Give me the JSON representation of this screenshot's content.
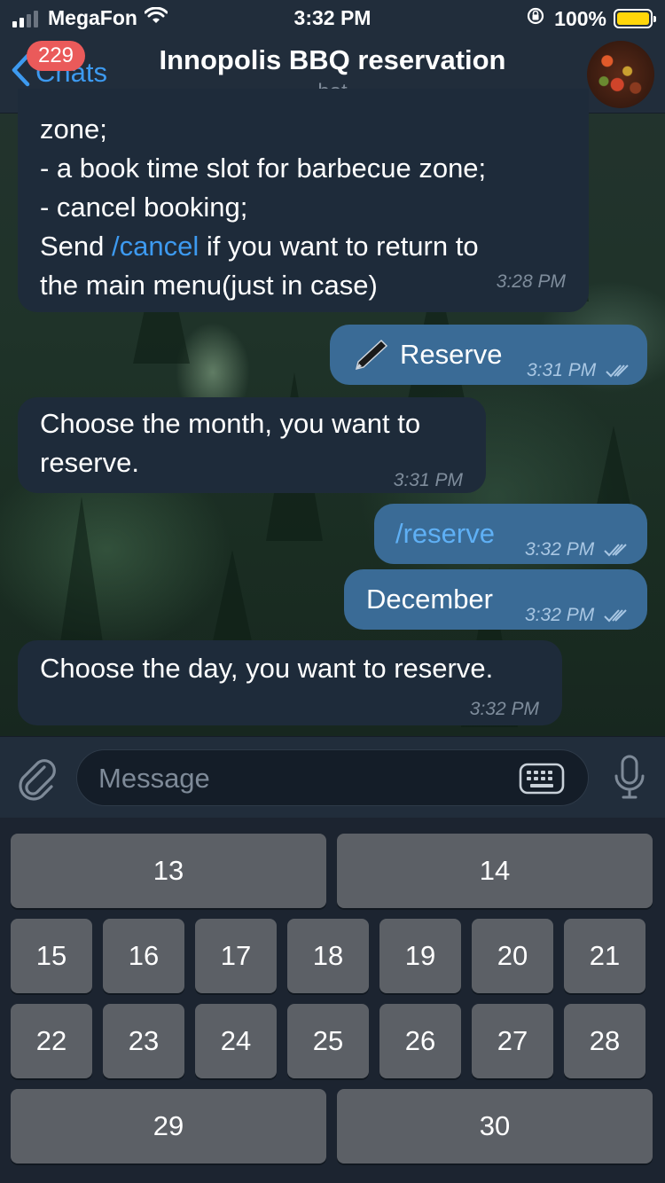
{
  "status_bar": {
    "carrier": "MegaFon",
    "time": "3:32 PM",
    "battery": "100%",
    "signal_bars": 4,
    "signal_bars_active": 2
  },
  "nav": {
    "back_label": "Chats",
    "unread_badge": "229",
    "title": "Innopolis BBQ reservation",
    "subtitle": "bot"
  },
  "messages": [
    {
      "direction": "in",
      "lines": [
        "zone;",
        "- a book time slot for barbecue zone;",
        "- cancel booking;"
      ],
      "line4_prefix": "Send ",
      "line4_link": "/cancel",
      "line4_suffix": " if you want to return to",
      "line5": "the main menu(just in case)",
      "time": "3:28 PM"
    },
    {
      "direction": "out",
      "emoji": "🖋",
      "text": "Reserve",
      "time": "3:31 PM"
    },
    {
      "direction": "in",
      "lines": [
        "Choose the month, you want to",
        "reserve."
      ],
      "time": "3:31 PM"
    },
    {
      "direction": "out",
      "text": "/reserve",
      "is_link": true,
      "time": "3:32 PM"
    },
    {
      "direction": "out",
      "text": "December",
      "time": "3:32 PM"
    },
    {
      "direction": "in",
      "text": "Choose the day, you want to reserve.",
      "time": "3:32 PM"
    }
  ],
  "input": {
    "placeholder": "Message"
  },
  "keyboard": {
    "rows": [
      [
        "13",
        "14"
      ],
      [
        "15",
        "16",
        "17",
        "18",
        "19",
        "20",
        "21"
      ],
      [
        "22",
        "23",
        "24",
        "25",
        "26",
        "27",
        "28"
      ],
      [
        "29",
        "30"
      ]
    ]
  },
  "colors": {
    "accent": "#3d9af0",
    "badge": "#ea5a5a",
    "incoming_bubble": "#1e2b3a",
    "outgoing_bubble": "#3a6b96",
    "key": "#5c6066",
    "battery": "#ffd60a"
  },
  "icons": {
    "back": "chevron-left-icon",
    "attach": "paperclip-icon",
    "keyboard": "keyboard-icon",
    "mic": "microphone-icon",
    "wifi": "wifi-icon",
    "read": "double-check-icon"
  }
}
